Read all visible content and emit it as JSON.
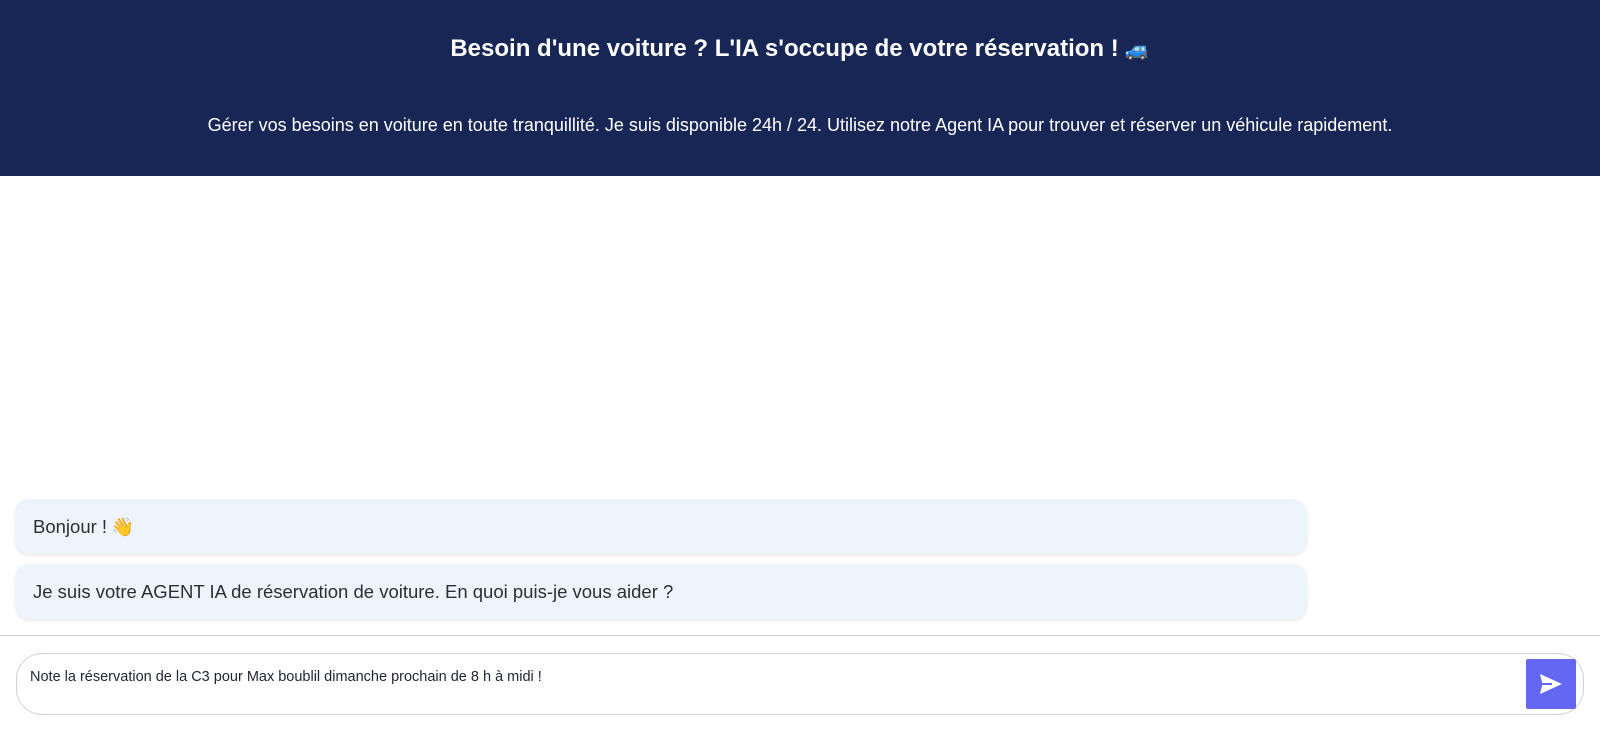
{
  "header": {
    "title": "Besoin d'une voiture ? L'IA s'occupe de votre réservation !",
    "title_emoji": "🚙",
    "subtitle": "Gérer vos besoins en voiture en toute tranquillité. Je suis disponible 24h / 24. Utilisez notre Agent IA pour trouver et réserver un véhicule rapidement."
  },
  "chat": {
    "messages": [
      {
        "text": "Bonjour !",
        "emoji": "👋"
      },
      {
        "text": "Je suis votre AGENT IA de réservation de voiture. En quoi puis-je vous aider ?"
      }
    ]
  },
  "composer": {
    "value": "Note la réservation de la C3 pour Max boublil dimanche prochain de 8 h à midi !",
    "send_icon": "send-icon"
  },
  "colors": {
    "header_bg": "#182656",
    "bubble_bg": "#eef4fc",
    "send_button_bg": "#6467f2"
  }
}
